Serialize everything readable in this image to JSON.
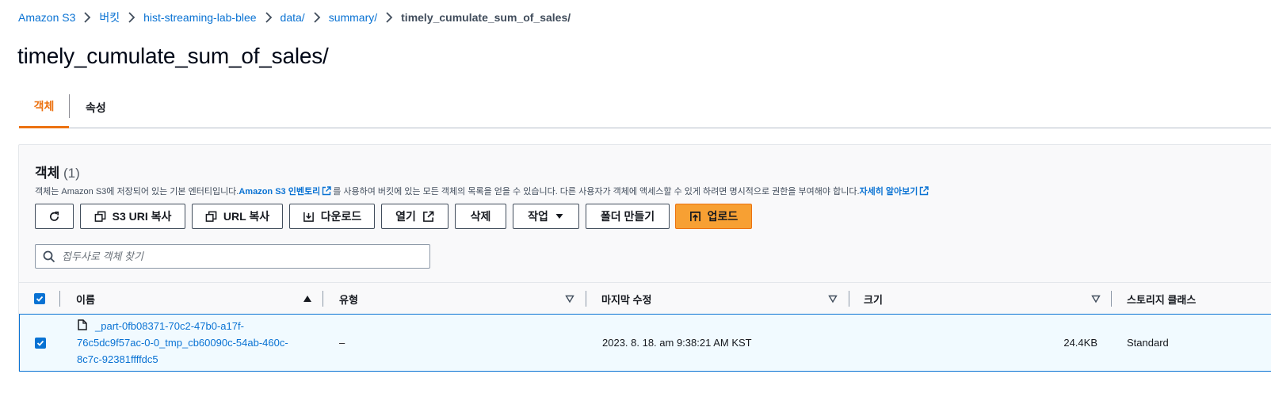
{
  "breadcrumb": {
    "items": [
      "Amazon S3",
      "버킷",
      "hist-streaming-lab-blee",
      "data/",
      "summary/"
    ],
    "current": "timely_cumulate_sum_of_sales/"
  },
  "page": {
    "title": "timely_cumulate_sum_of_sales/"
  },
  "tabs": {
    "objects": "객체",
    "properties": "속성"
  },
  "panel": {
    "title": "객체",
    "count": "(1)",
    "desc_1": "객체는 Amazon S3에 저장되어 있는 기본 엔터티입니다. ",
    "desc_link_1": "Amazon S3 인벤토리",
    "desc_2": "를 사용하여 버킷에 있는 모든 객체의 목록을 얻을 수 있습니다. 다른 사용자가 객체에 액세스할 수 있게 하려면 명시적으로 권한을 부여해야 합니다. ",
    "desc_link_2": "자세히 알아보기"
  },
  "toolbar": {
    "copy_s3_uri": "S3 URI 복사",
    "copy_url": "URL 복사",
    "download": "다운로드",
    "open": "열기",
    "delete": "삭제",
    "actions": "작업",
    "create_folder": "폴더 만들기",
    "upload": "업로드"
  },
  "search": {
    "placeholder": "접두사로 객체 찾기"
  },
  "table": {
    "columns": {
      "name": "이름",
      "type": "유형",
      "modified": "마지막 수정",
      "size": "크기",
      "storage": "스토리지 클래스"
    },
    "rows": [
      {
        "name_line1": "_part-0fb08371-70c2-47b0-a17f-",
        "name_line2": "76c5dc9f57ac-0-0_tmp_cb60090c-54ab-460c-",
        "name_line3": "8c7c-92381ffffdc5",
        "type": "–",
        "modified": "2023. 8. 18. am 9:38:21 AM KST",
        "size": "24.4KB",
        "storage": "Standard"
      }
    ]
  },
  "colors": {
    "accent": "#ec7211",
    "link": "#0972d3",
    "primary_button": "#f7a033"
  }
}
